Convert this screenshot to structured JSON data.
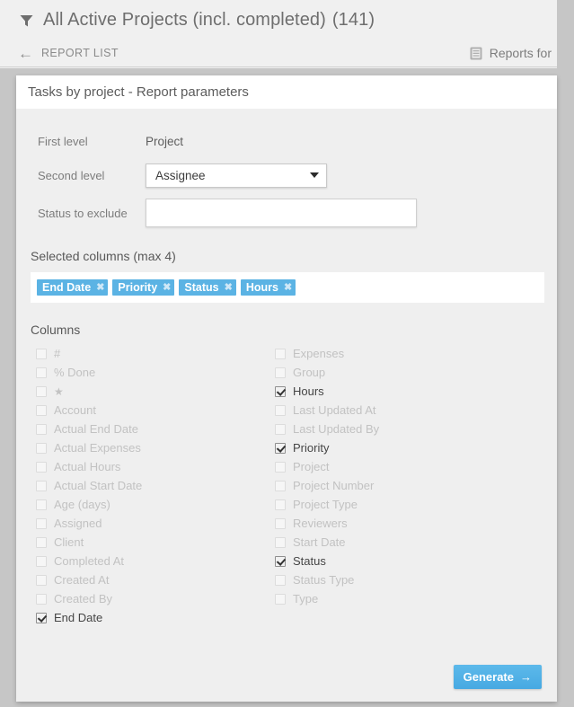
{
  "header": {
    "filter_icon": "filter-icon",
    "title": "All Active Projects (incl. completed)",
    "count": "(141)",
    "back_arrow_icon": "arrow-left-icon",
    "back_label": "REPORT LIST",
    "book_icon": "book-icon",
    "reports_for_label": "Reports for"
  },
  "card": {
    "title": "Tasks by project - Report parameters"
  },
  "form": {
    "first_level": {
      "label": "First level",
      "value": "Project"
    },
    "second_level": {
      "label": "Second level",
      "value": "Assignee",
      "caret_icon": "chevron-down-icon"
    },
    "status_to_exclude": {
      "label": "Status to exclude",
      "value": "",
      "placeholder": ""
    }
  },
  "selected_columns": {
    "title": "Selected columns (max 4)",
    "chip_color": "#5bb3e4",
    "remove_icon": "close-icon",
    "chips": [
      {
        "label": "End Date"
      },
      {
        "label": "Priority"
      },
      {
        "label": "Status"
      },
      {
        "label": "Hours"
      }
    ]
  },
  "columns": {
    "title": "Columns",
    "left": [
      {
        "label": "#",
        "checked": false
      },
      {
        "label": "% Done",
        "checked": false
      },
      {
        "label": "★",
        "checked": false
      },
      {
        "label": "Account",
        "checked": false
      },
      {
        "label": "Actual End Date",
        "checked": false
      },
      {
        "label": "Actual Expenses",
        "checked": false
      },
      {
        "label": "Actual Hours",
        "checked": false
      },
      {
        "label": "Actual Start Date",
        "checked": false
      },
      {
        "label": "Age (days)",
        "checked": false
      },
      {
        "label": "Assigned",
        "checked": false
      },
      {
        "label": "Client",
        "checked": false
      },
      {
        "label": "Completed At",
        "checked": false
      },
      {
        "label": "Created At",
        "checked": false
      },
      {
        "label": "Created By",
        "checked": false
      },
      {
        "label": "End Date",
        "checked": true
      }
    ],
    "right": [
      {
        "label": "Expenses",
        "checked": false
      },
      {
        "label": "Group",
        "checked": false
      },
      {
        "label": "Hours",
        "checked": true
      },
      {
        "label": "Last Updated At",
        "checked": false
      },
      {
        "label": "Last Updated By",
        "checked": false
      },
      {
        "label": "Priority",
        "checked": true
      },
      {
        "label": "Project",
        "checked": false
      },
      {
        "label": "Project Number",
        "checked": false
      },
      {
        "label": "Project Type",
        "checked": false
      },
      {
        "label": "Reviewers",
        "checked": false
      },
      {
        "label": "Start Date",
        "checked": false
      },
      {
        "label": "Status",
        "checked": true
      },
      {
        "label": "Status Type",
        "checked": false
      },
      {
        "label": "Type",
        "checked": false
      }
    ]
  },
  "footer": {
    "generate_label": "Generate",
    "generate_arrow": "→",
    "button_color": "#47a9e2"
  }
}
